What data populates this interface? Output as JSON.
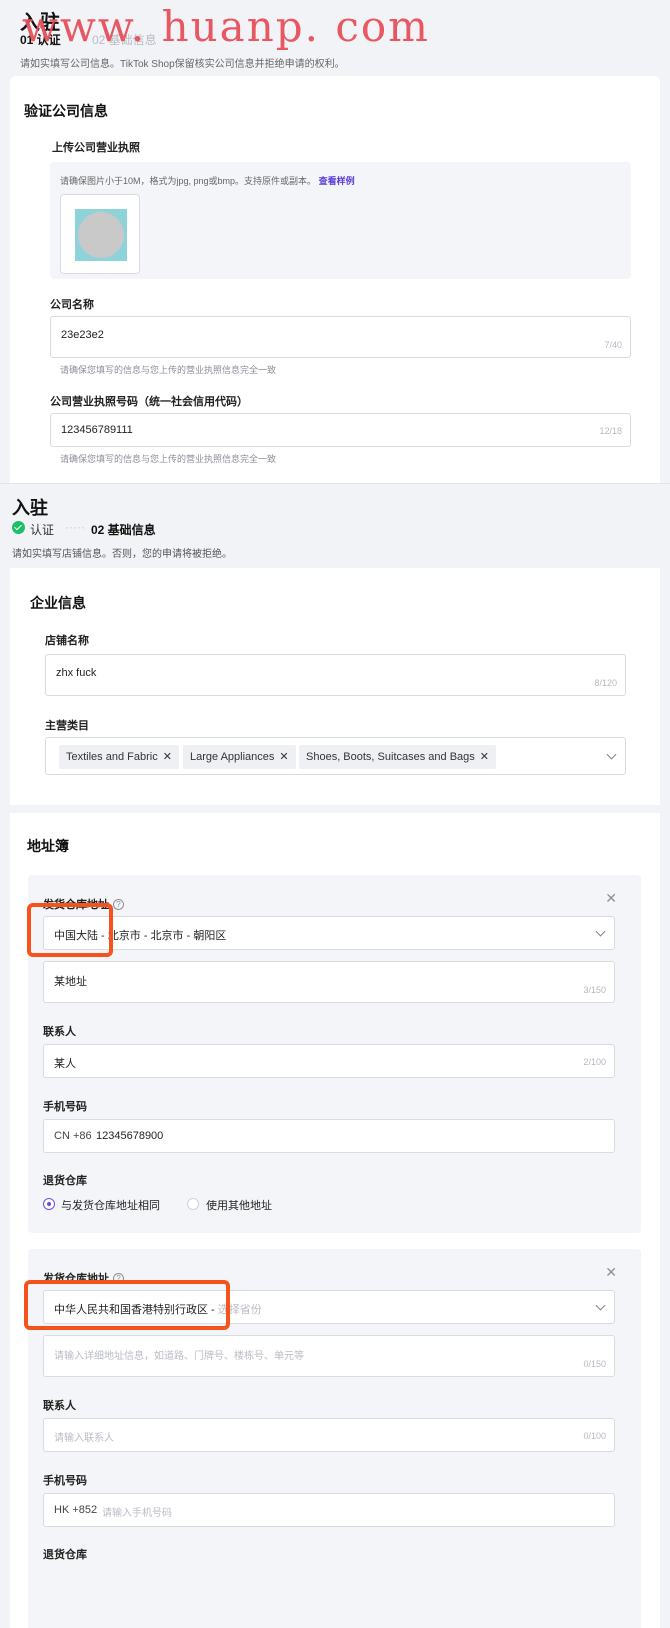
{
  "watermark": "www. huanp. com",
  "top": {
    "page_title": "入驻",
    "step1": "01 认证",
    "step2": "02 基础信息",
    "subtitle": "请如实填写公司信息。TikTok Shop保留核实公司信息并拒绝申请的权利。",
    "section_title": "验证公司信息",
    "license_label": "上传公司营业执照",
    "upload_hint": "请确保图片小于10M，格式为jpg, png或bmp。支持原件或副本。",
    "view_example": "查看样例",
    "company_name_label": "公司名称",
    "company_name_value": "23e23e2",
    "company_name_count": "7/40",
    "company_name_hint": "请确保您填写的信息与您上传的营业执照信息完全一致",
    "license_no_label": "公司营业执照号码（统一社会信用代码）",
    "license_no_value": "123456789111",
    "license_no_count": "12/18",
    "license_no_hint": "请确保您填写的信息与您上传的营业执照信息完全一致"
  },
  "bottom": {
    "page_title": "入驻",
    "step1": "认证",
    "step_dots": "·····",
    "step2": "02 基础信息",
    "subtitle": "请如实填写店铺信息。否则，您的申请将被拒绝。",
    "enterprise": {
      "title": "企业信息",
      "shop_name_label": "店铺名称",
      "shop_name_value": "zhx fuck",
      "shop_name_count": "8/120",
      "category_label": "主营类目",
      "categories": [
        "Textiles and Fabric",
        "Large Appliances",
        "Shoes, Boots, Suitcases and Bags"
      ]
    },
    "address_book": {
      "title": "地址簿",
      "card1": {
        "warehouse_label": "发货仓库地址",
        "region_value": "中国大陆 - 北京市 - 北京市 - 朝阳区",
        "detail_value": "某地址",
        "detail_count": "3/150",
        "contact_label": "联系人",
        "contact_value": "某人",
        "contact_count": "2/100",
        "phone_label": "手机号码",
        "phone_code": "CN +86",
        "phone_value": "12345678900",
        "return_label": "退货仓库",
        "return_opt1": "与发货仓库地址相同",
        "return_opt2": "使用其他地址"
      },
      "card2": {
        "warehouse_label": "发货仓库地址",
        "region_value": "中华人民共和国香港特别行政区 - ",
        "region_placeholder": "选择省份",
        "detail_placeholder": "请输入详细地址信息，如道路、门牌号、楼栋号、单元等",
        "detail_count": "0/150",
        "contact_label": "联系人",
        "contact_placeholder": "请输入联系人",
        "contact_count": "0/100",
        "phone_label": "手机号码",
        "phone_code": "HK +852",
        "phone_placeholder": "请输入手机号码",
        "return_label": "退货仓库"
      }
    }
  },
  "colors": {
    "accent": "#6d4de6",
    "link": "#5b3fd6",
    "highlight": "#f5531b",
    "success": "#1fbf6a",
    "watermark": "#e8505b"
  }
}
